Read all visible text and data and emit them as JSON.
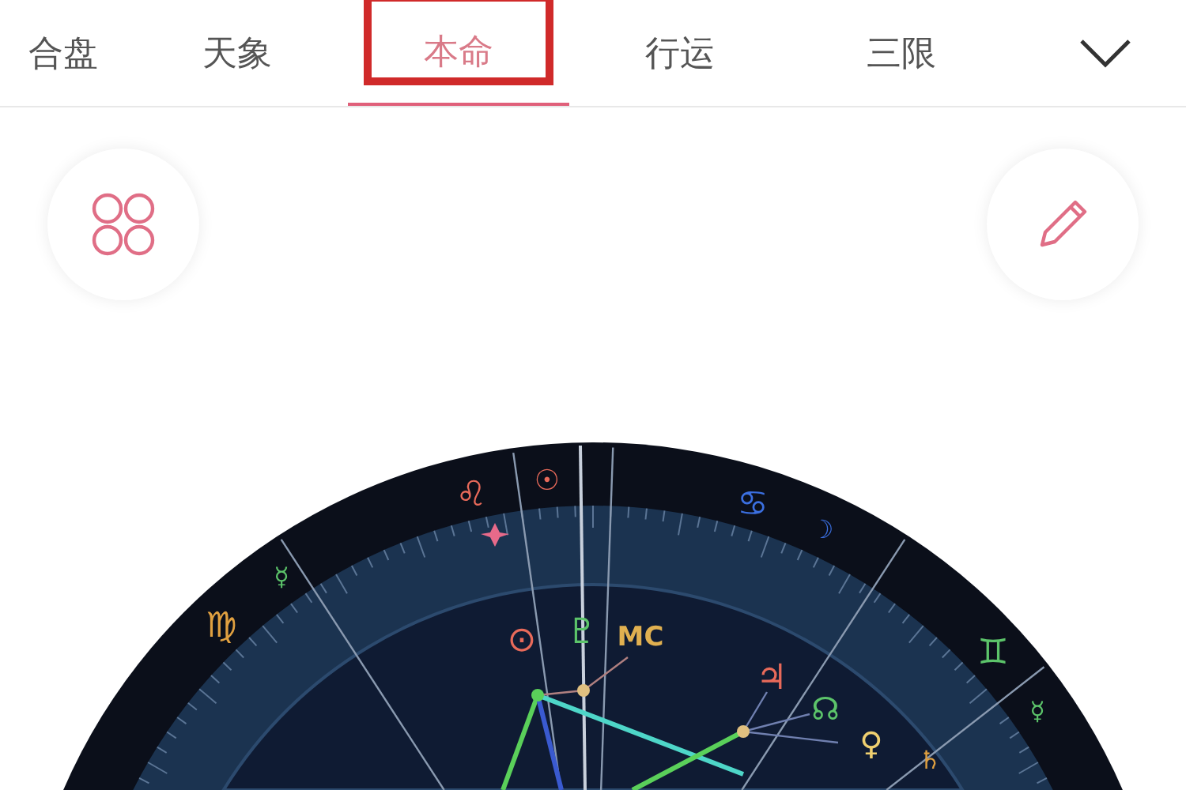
{
  "tabs": [
    {
      "label": "合盘",
      "selected": false,
      "outlined": false
    },
    {
      "label": "天象",
      "selected": false,
      "outlined": false
    },
    {
      "label": "本命",
      "selected": true,
      "outlined": true
    },
    {
      "label": "行运",
      "selected": false,
      "outlined": false
    },
    {
      "label": "三限",
      "selected": false,
      "outlined": false
    }
  ],
  "chart_glyphs": [
    {
      "text": "♌",
      "color": "#e86a5a"
    },
    {
      "text": "☉",
      "color": "#e86a5a"
    },
    {
      "text": "♋",
      "color": "#3b6fe0"
    },
    {
      "text": "☽",
      "color": "#3b6fe0"
    },
    {
      "text": "☿",
      "color": "#5cc46a"
    },
    {
      "text": "♍",
      "color": "#e0a040"
    },
    {
      "text": "♊",
      "color": "#5cc46a"
    },
    {
      "text": "☿",
      "color": "#5cc46a"
    },
    {
      "text": "⊙",
      "color": "#e86a5a"
    },
    {
      "text": "♇",
      "color": "#5cc46a"
    },
    {
      "text": "MC",
      "color": "#e0b050"
    },
    {
      "text": "♃",
      "color": "#e86a5a"
    },
    {
      "text": "☊",
      "color": "#5cc46a"
    },
    {
      "text": "♀",
      "color": "#f0d070"
    },
    {
      "text": "♄",
      "color": "#e0a040"
    }
  ]
}
